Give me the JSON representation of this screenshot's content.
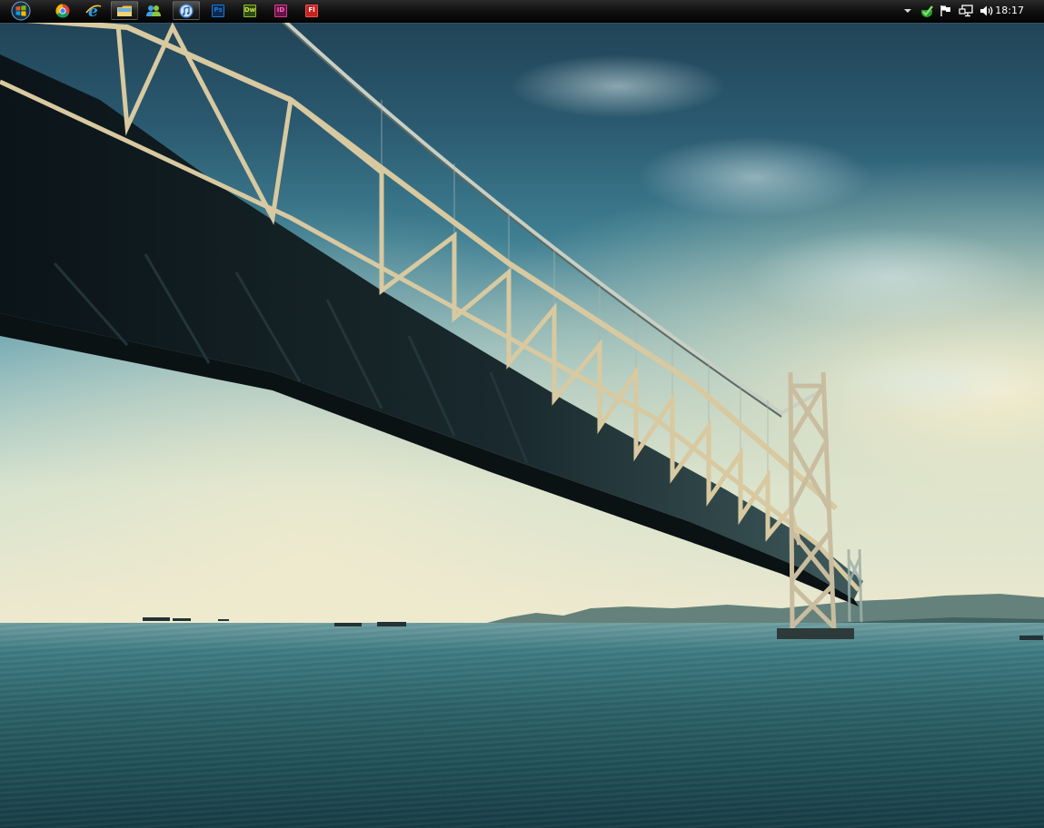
{
  "taskbar": {
    "start": {
      "icon": "windows-start-orb-icon"
    },
    "pinned": [
      {
        "name": "chrome",
        "icon": "chrome-icon",
        "active": false
      },
      {
        "name": "internet-explorer",
        "icon": "internet-explorer-icon",
        "active": false
      },
      {
        "name": "windows-explorer",
        "icon": "folder-icon",
        "active": true
      },
      {
        "name": "windows-live-messenger",
        "icon": "messenger-icon",
        "active": false
      },
      {
        "name": "itunes",
        "icon": "itunes-icon",
        "active": true
      },
      {
        "name": "photoshop",
        "icon": "photoshop-icon",
        "label": "Ps",
        "color": "#1c78d6",
        "bg": "#0b2a4e",
        "active": false
      },
      {
        "name": "dreamweaver",
        "icon": "dreamweaver-icon",
        "label": "Dw",
        "color": "#c9e14a",
        "bg": "#2c4a12",
        "active": false
      },
      {
        "name": "indesign",
        "icon": "indesign-icon",
        "label": "ID",
        "color": "#ff69b4",
        "bg": "#66124a",
        "active": false
      },
      {
        "name": "flash",
        "icon": "flash-icon",
        "label": "Fl",
        "color": "#ffffff",
        "bg": "#c8201c",
        "active": false
      }
    ]
  },
  "tray": {
    "icons": [
      "show-hidden-icons-chevron-icon",
      "security-check-icon",
      "action-center-flag-icon",
      "network-icon",
      "volume-icon"
    ],
    "clock": "18:17"
  },
  "colors": {
    "taskbar_bg": "#0e0e0e",
    "sky_top": "#1f3f52",
    "horizon": "#efe9cf",
    "sea": "#2c6369"
  }
}
